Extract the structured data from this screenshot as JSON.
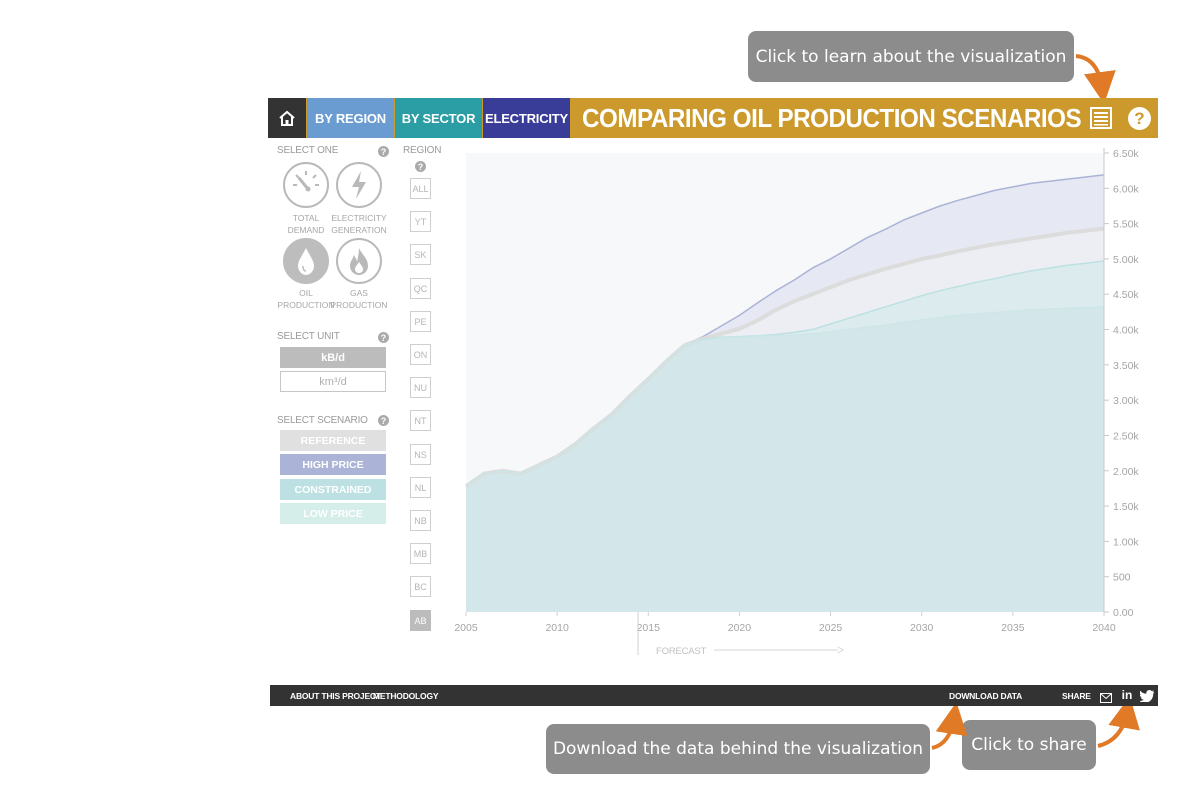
{
  "callouts": {
    "learn": "Click to learn about the visualization",
    "download": "Download the data behind the visualization",
    "share": "Click to share"
  },
  "nav": {
    "home_icon": "home-icon",
    "by_region": "BY REGION",
    "by_sector": "BY SECTOR",
    "electricity": "ELECTRICITY",
    "title": "COMPARING OIL PRODUCTION SCENARIOS",
    "list_icon": "list-icon",
    "help_icon": "help-icon"
  },
  "colors": {
    "gold": "#cc9a2c",
    "by_region": "#6a9bd1",
    "by_sector": "#2a9ea4",
    "electricity": "#3a3d98",
    "home": "#333333",
    "reference": "#e0e0e0",
    "high_price": "#abb4d6",
    "constrained": "#bde1e3",
    "low_price": "#d5eee9",
    "callout": "#8c8c8c",
    "arrow": "#e07a26"
  },
  "sidebar": {
    "select_one": "SELECT ONE",
    "indicators": [
      {
        "line1": "TOTAL",
        "line2": "DEMAND",
        "icon": "gauge-icon"
      },
      {
        "line1": "ELECTRICITY",
        "line2": "GENERATION",
        "icon": "lightning-icon"
      },
      {
        "line1": "OIL",
        "line2": "PRODUCTION",
        "icon": "oil-drop-icon"
      },
      {
        "line1": "GAS",
        "line2": "PRODUCTION",
        "icon": "flame-icon"
      }
    ],
    "select_unit": "SELECT UNIT",
    "units": [
      "kB/d",
      "km³/d"
    ],
    "select_scenario": "SELECT SCENARIO",
    "scenarios": [
      "REFERENCE",
      "HIGH PRICE",
      "CONSTRAINED",
      "LOW PRICE"
    ]
  },
  "region": {
    "label": "REGION",
    "items": [
      "ALL",
      "YT",
      "SK",
      "QC",
      "PE",
      "ON",
      "NU",
      "NT",
      "NS",
      "NL",
      "NB",
      "MB",
      "BC",
      "AB"
    ],
    "active": "AB"
  },
  "chart_data": {
    "type": "area",
    "x": [
      2005,
      2006,
      2007,
      2008,
      2009,
      2010,
      2011,
      2012,
      2013,
      2014,
      2015,
      2016,
      2017,
      2018,
      2019,
      2020,
      2021,
      2022,
      2023,
      2024,
      2025,
      2026,
      2027,
      2028,
      2029,
      2030,
      2031,
      2032,
      2033,
      2034,
      2035,
      2036,
      2037,
      2038,
      2039,
      2040
    ],
    "series": [
      {
        "name": "HIGH PRICE",
        "values": [
          1780,
          1960,
          2000,
          1960,
          2080,
          2200,
          2380,
          2600,
          2800,
          3060,
          3300,
          3550,
          3780,
          3900,
          4050,
          4200,
          4380,
          4550,
          4700,
          4870,
          5000,
          5150,
          5300,
          5420,
          5550,
          5650,
          5750,
          5830,
          5900,
          5970,
          6020,
          6070,
          6100,
          6130,
          6160,
          6190
        ]
      },
      {
        "name": "REFERENCE",
        "values": [
          1780,
          1960,
          2000,
          1960,
          2080,
          2200,
          2380,
          2600,
          2800,
          3060,
          3300,
          3550,
          3780,
          3870,
          3940,
          4010,
          4130,
          4280,
          4400,
          4500,
          4600,
          4700,
          4780,
          4860,
          4930,
          5000,
          5050,
          5110,
          5160,
          5210,
          5250,
          5290,
          5330,
          5370,
          5400,
          5430
        ]
      },
      {
        "name": "LOW PRICE",
        "values": [
          1780,
          1960,
          2000,
          1960,
          2080,
          2200,
          2380,
          2600,
          2800,
          3060,
          3300,
          3550,
          3780,
          3860,
          3890,
          3900,
          3910,
          3930,
          3960,
          4000,
          4080,
          4160,
          4240,
          4320,
          4400,
          4480,
          4550,
          4610,
          4670,
          4720,
          4780,
          4830,
          4870,
          4910,
          4940,
          4970
        ]
      },
      {
        "name": "CONSTRAINED",
        "values": [
          1780,
          1960,
          2000,
          1960,
          2080,
          2200,
          2380,
          2600,
          2800,
          3060,
          3300,
          3550,
          3780,
          3850,
          3880,
          3890,
          3900,
          3910,
          3920,
          3940,
          3970,
          4000,
          4030,
          4060,
          4100,
          4140,
          4170,
          4200,
          4220,
          4240,
          4260,
          4280,
          4290,
          4300,
          4310,
          4320
        ]
      }
    ],
    "x_ticks": [
      "2005",
      "2010",
      "2015",
      "2020",
      "2025",
      "2030",
      "2035",
      "2040"
    ],
    "y_ticks": [
      "0.00",
      "500",
      "1.00k",
      "1.50k",
      "2.00k",
      "2.50k",
      "3.00k",
      "3.50k",
      "4.00k",
      "4.50k",
      "5.00k",
      "5.50k",
      "6.00k",
      "6.50k"
    ],
    "ylim": [
      0,
      6500
    ],
    "xlim": [
      2005,
      2040
    ],
    "forecast_label": "FORECAST",
    "forecast_start": 2014
  },
  "footer": {
    "about": "ABOUT THIS PROJECT",
    "methodology": "METHODOLOGY",
    "download": "DOWNLOAD DATA",
    "share": "SHARE",
    "email_icon": "email-icon",
    "linkedin_icon": "linkedin-icon",
    "twitter_icon": "twitter-icon"
  }
}
